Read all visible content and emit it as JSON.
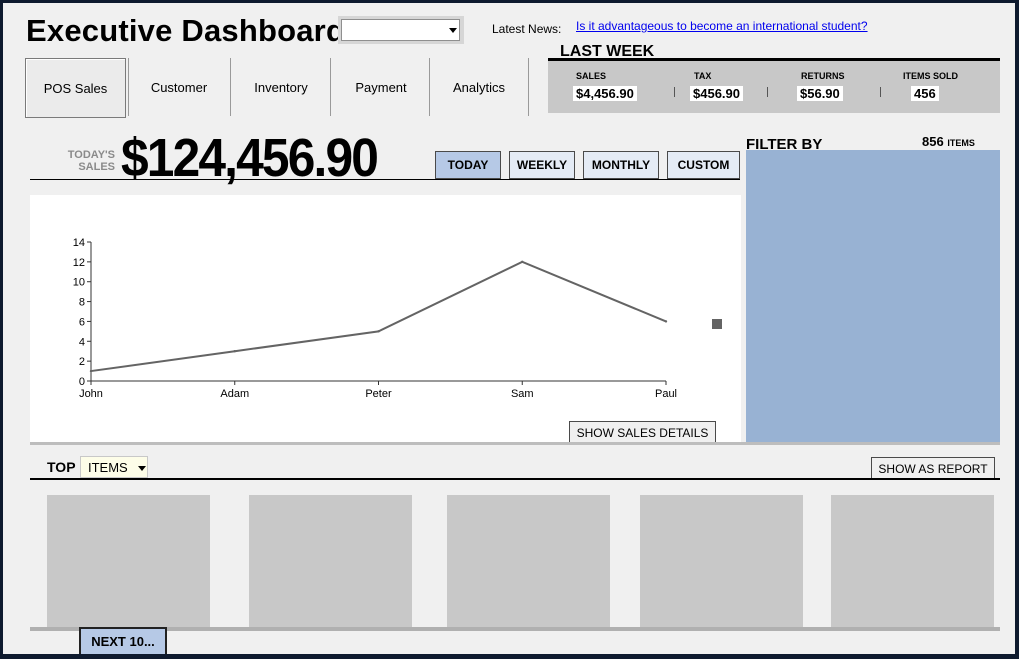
{
  "header": {
    "title": "Executive Dashboard",
    "news_label": "Latest News:",
    "news_link": "Is it advantageous to become an international student?"
  },
  "tabs": [
    {
      "label": "POS Sales",
      "active": true
    },
    {
      "label": "Customer",
      "active": false
    },
    {
      "label": "Inventory",
      "active": false
    },
    {
      "label": "Payment",
      "active": false
    },
    {
      "label": "Analytics",
      "active": false
    }
  ],
  "last_week": {
    "title": "LAST WEEK",
    "sales_label": "SALES",
    "sales_value": "$4,456.90",
    "tax_label": "TAX",
    "tax_value": "$456.90",
    "returns_label": "RETURNS",
    "returns_value": "$56.90",
    "items_label": "ITEMS SOLD",
    "items_value": "456"
  },
  "today": {
    "label_line1": "TODAY'S",
    "label_line2": "SALES",
    "value": "$124,456.90"
  },
  "range_buttons": {
    "today": "TODAY",
    "weekly": "WEEKLY",
    "monthly": "MONTHLY",
    "custom": "CUSTOM",
    "active": "today"
  },
  "chart_data": {
    "type": "line",
    "categories": [
      "John",
      "Adam",
      "Peter",
      "Sam",
      "Paul"
    ],
    "series": [
      {
        "values": [
          1,
          3,
          5,
          12,
          6
        ]
      }
    ],
    "ylim": [
      0,
      14
    ],
    "yticks": [
      "0",
      "2",
      "4",
      "6",
      "8",
      "10",
      "12",
      "14"
    ],
    "legend": "right",
    "grid": false,
    "line_color": "#646464"
  },
  "show_sales_details": "SHOW SALES DETAILS",
  "filter": {
    "title": "FILTER BY",
    "count": "856",
    "unit": "ITEMS",
    "panel_color": "#98b2d3"
  },
  "top_items": {
    "label": "TOP",
    "selected": "ITEMS",
    "show_report": "SHOW AS REPORT",
    "next_button": "NEXT 10..."
  },
  "colors": {
    "accent_button": "#b6c9e6",
    "card_gray": "#c8c8c8"
  }
}
